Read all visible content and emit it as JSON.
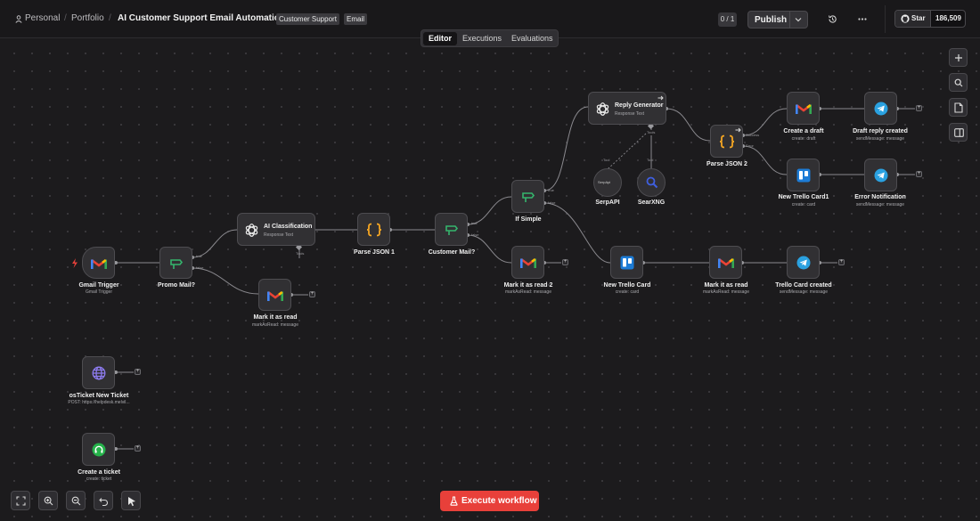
{
  "header": {
    "breadcrumb": [
      "Personal",
      "Portfolio"
    ],
    "workflow_title": "AI Customer Support Email Automation",
    "tags": [
      "Customer Support",
      "Email"
    ],
    "version_counter": "0 / 1",
    "publish_label": "Publish",
    "github_star_label": "Star",
    "github_star_count": "186,509"
  },
  "tabs": [
    "Editor",
    "Executions",
    "Evaluations"
  ],
  "active_tab": "Editor",
  "nodes": {
    "gmail_trigger": {
      "title": "Gmail Trigger",
      "subtitle": "Gmail Trigger"
    },
    "promo_mail": {
      "title": "Promo Mail?",
      "out_true": "true",
      "out_false": "false"
    },
    "mark_read_1": {
      "title": "Mark it as read",
      "subtitle": "markAsRead: message"
    },
    "ai_classification": {
      "title": "AI Classification",
      "subtitle": "Response Text",
      "port": "Tools"
    },
    "parse_json_1": {
      "title": "Parse JSON 1"
    },
    "customer_mail": {
      "title": "Customer Mail?",
      "out_true": "true",
      "out_false": "false"
    },
    "mark_read_2": {
      "title": "Mark it as read 2",
      "subtitle": "markAsRead: message"
    },
    "if_simple": {
      "title": "If Simple",
      "out_true": "true",
      "out_false": "false"
    },
    "reply_generator": {
      "title": "Reply Generator",
      "subtitle": "Response Text",
      "port": "Tools"
    },
    "serpapi": {
      "title": "SerpAPI",
      "port": "Tool",
      "logo_text": "SerpApi"
    },
    "searxng": {
      "title": "SearXNG",
      "port": "Tool"
    },
    "new_trello_card": {
      "title": "New Trello Card",
      "subtitle": "create: card"
    },
    "mark_read_3": {
      "title": "Mark it as read",
      "subtitle": "markAsRead: message"
    },
    "trello_card_created": {
      "title": "Trello Card created",
      "subtitle": "sendMessage: message"
    },
    "parse_json_2": {
      "title": "Parse JSON 2",
      "out_success": "Success",
      "out_error": "Error"
    },
    "create_draft": {
      "title": "Create a draft",
      "subtitle": "create: draft"
    },
    "draft_reply_created": {
      "title": "Draft reply created",
      "subtitle": "sendMessage: message"
    },
    "new_trello_card1": {
      "title": "New Trello Card1",
      "subtitle": "create: card"
    },
    "error_notification": {
      "title": "Error Notification",
      "subtitle": "sendMessage: message"
    },
    "osticket_new_ticket": {
      "title": "osTicket New Ticket",
      "subtitle": "POST: https://helpdesk.melvil..."
    },
    "create_ticket": {
      "title": "Create a ticket",
      "subtitle": "create: ticket"
    }
  },
  "right_toolbar": [
    "plus-icon",
    "search-icon",
    "sticky-note-icon",
    "panel-icon"
  ],
  "bottom_toolbar": [
    "fit-view-icon",
    "zoom-in-icon",
    "zoom-out-icon",
    "undo-icon",
    "pointer-icon"
  ],
  "execute_button_label": "Execute workflow",
  "colors": {
    "accent": "#e8403a",
    "canvas": "#1c1b1d",
    "node": "#313033",
    "gmail_red": "#ea4335",
    "telegram_blue": "#2aa1e0",
    "trello_blue": "#1d7cd6",
    "if_green": "#35b56d",
    "json_orange": "#f5a623"
  }
}
